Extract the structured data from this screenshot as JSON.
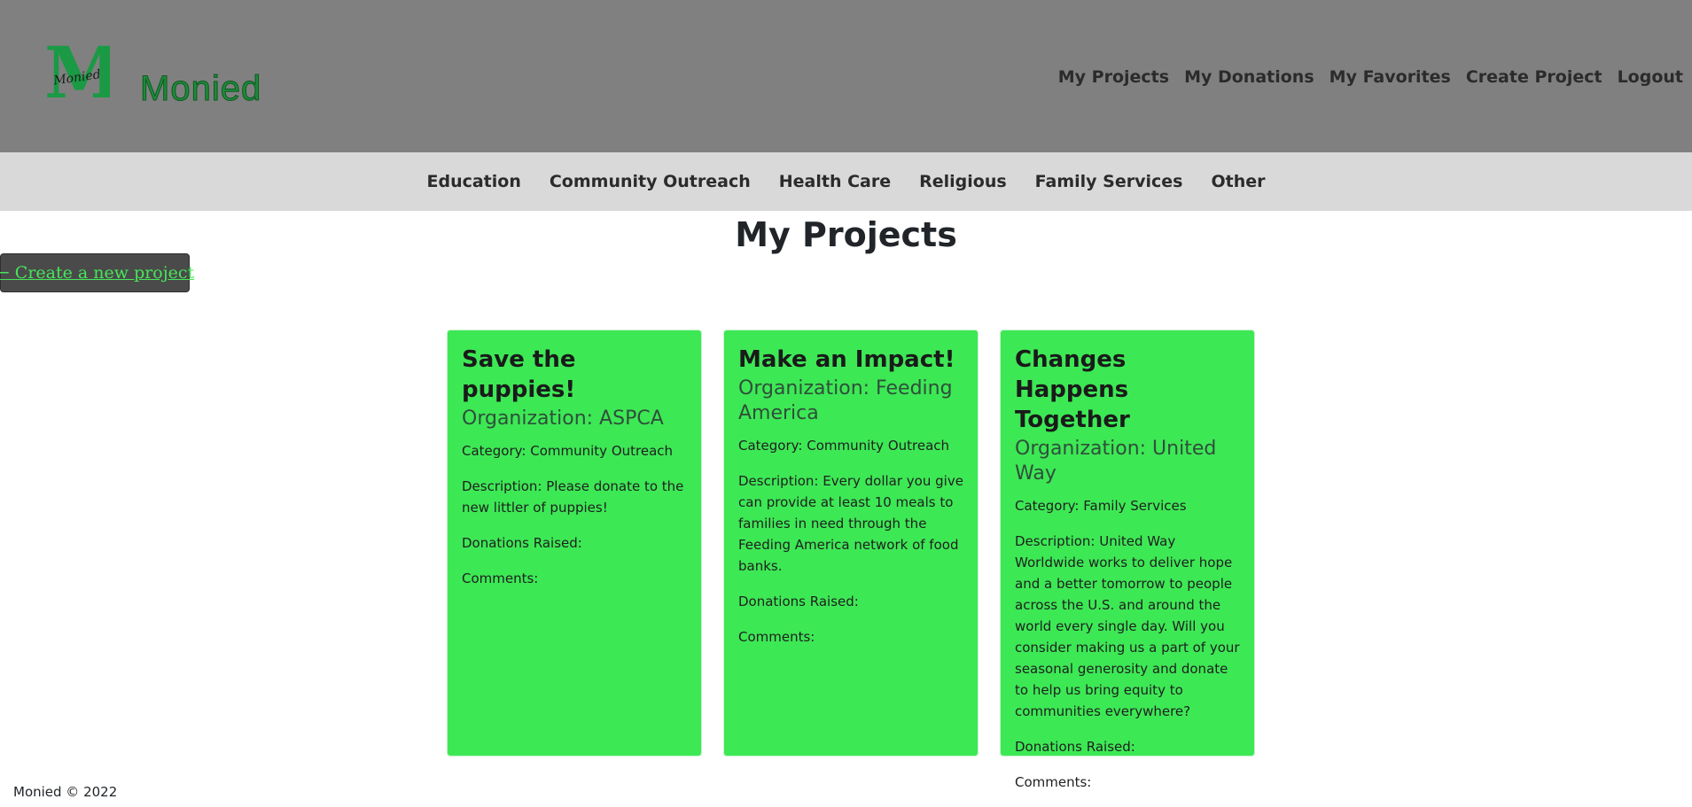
{
  "brand": {
    "name": "Monied",
    "logo_letter": "M",
    "logo_script": "Monied"
  },
  "top_nav": [
    {
      "label": "My Projects"
    },
    {
      "label": "My Donations"
    },
    {
      "label": "My Favorites"
    },
    {
      "label": "Create Project"
    },
    {
      "label": "Logout"
    }
  ],
  "categories": [
    {
      "label": "Education"
    },
    {
      "label": "Community Outreach"
    },
    {
      "label": "Health Care"
    },
    {
      "label": "Religious"
    },
    {
      "label": "Family Services"
    },
    {
      "label": "Other"
    }
  ],
  "page": {
    "title": "My Projects",
    "create_link": "← Create a new project"
  },
  "projects": [
    {
      "title": "Save the puppies!",
      "organization": "Organization: ASPCA",
      "category": "Category: Community Outreach",
      "description": "Description: Please donate to the new littler of puppies!",
      "donations": "Donations Raised:",
      "comments": "Comments:"
    },
    {
      "title": "Make an Impact!",
      "organization": "Organization: Feeding America",
      "category": "Category: Community Outreach",
      "description": "Description: Every dollar you give can provide at least 10 meals to families in need through the Feeding America network of food banks.",
      "donations": "Donations Raised:",
      "comments": "Comments:"
    },
    {
      "title": "Changes Happens Together",
      "organization": "Organization: United Way",
      "category": "Category: Family Services",
      "description": "Description: United Way Worldwide works to deliver hope and a better tomorrow to people across the U.S. and around the world every single day. Will you consider making us a part of your seasonal generosity and donate to help us bring equity to communities everywhere?",
      "donations": "Donations Raised:",
      "comments": "Comments:"
    }
  ],
  "footer": {
    "text": "Monied © 2022"
  },
  "colors": {
    "header_bg": "#808080",
    "category_bar_bg": "#d9d9d9",
    "card_bg": "#3de855",
    "brand_green": "#1f8a3a",
    "link_green": "#46e65a",
    "button_bg": "#4a4a4a"
  }
}
